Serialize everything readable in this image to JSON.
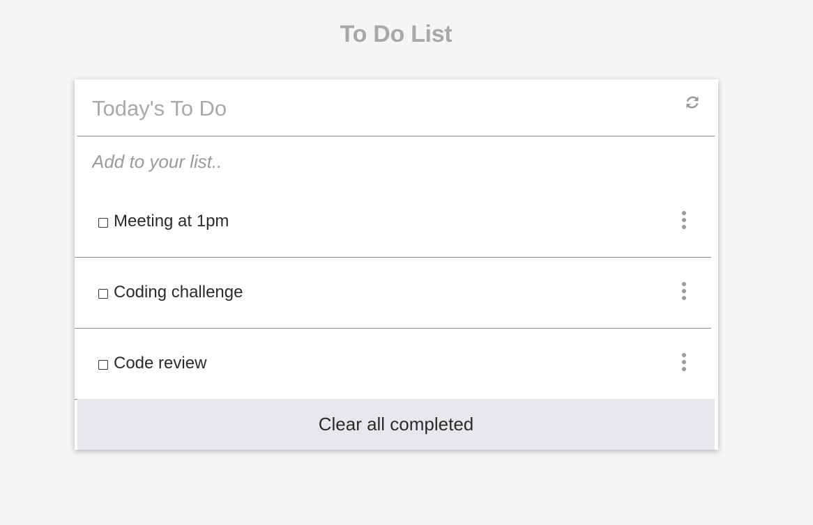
{
  "page": {
    "title": "To Do List"
  },
  "card": {
    "title": "Today's To Do",
    "refresh_icon": "refresh-icon"
  },
  "add_input": {
    "placeholder": "Add to your list..",
    "value": ""
  },
  "todos": [
    {
      "text": "Meeting at 1pm",
      "checked": false,
      "menu_icon": "kebab-icon"
    },
    {
      "text": "Coding challenge",
      "checked": false,
      "menu_icon": "kebab-icon"
    },
    {
      "text": "Code review",
      "checked": false,
      "menu_icon": "kebab-icon"
    }
  ],
  "footer": {
    "clear_label": "Clear all completed"
  },
  "colors": {
    "background": "#f5f5f5",
    "card": "#ffffff",
    "muted_text": "#a8a8a8",
    "divider": "#8a8a8a",
    "clear_button_bg": "#e8e8ec"
  }
}
